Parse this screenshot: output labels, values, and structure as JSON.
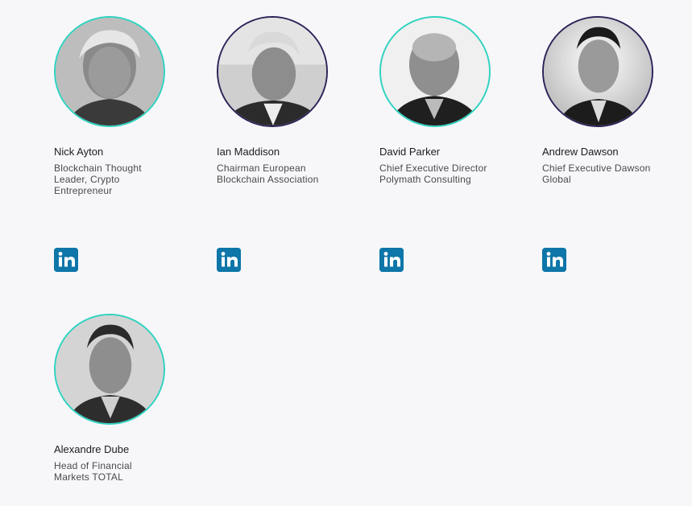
{
  "colors": {
    "teal_ring": "#2ed3c0",
    "navy_ring": "#2a2458",
    "linkedin": "#0e76a8",
    "background": "#f7f7fa"
  },
  "team": [
    {
      "name": "Nick Ayton",
      "role": "Blockchain Thought Leader, Crypto Entrepreneur",
      "ring": "teal",
      "linkedin_icon": "linkedin-icon"
    },
    {
      "name": "Ian Maddison",
      "role": "Chairman European Blockchain Association",
      "ring": "navy",
      "linkedin_icon": "linkedin-icon"
    },
    {
      "name": "David Parker",
      "role": "Chief Executive Director Polymath Consulting",
      "ring": "teal",
      "linkedin_icon": "linkedin-icon"
    },
    {
      "name": "Andrew Dawson",
      "role": "Chief Executive Dawson Global",
      "ring": "navy",
      "linkedin_icon": "linkedin-icon"
    },
    {
      "name": "Alexandre Dube",
      "role": "Head of Financial Markets TOTAL",
      "ring": "teal",
      "linkedin_icon": ""
    }
  ]
}
